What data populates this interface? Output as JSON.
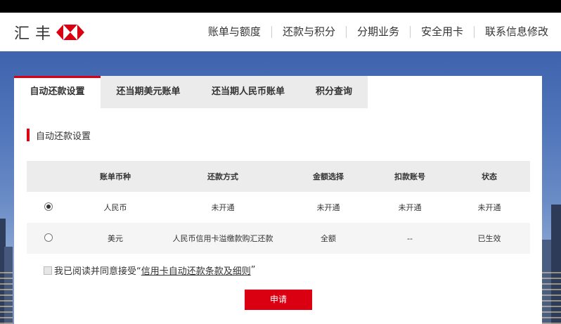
{
  "brand": {
    "name": "汇丰"
  },
  "nav": [
    {
      "label": "账单与额度"
    },
    {
      "label": "还款与积分"
    },
    {
      "label": "分期业务"
    },
    {
      "label": "安全用卡"
    },
    {
      "label": "联系信息修改"
    }
  ],
  "tabs": [
    {
      "label": "自动还款设置"
    },
    {
      "label": "还当期美元账单"
    },
    {
      "label": "还当期人民币账单"
    },
    {
      "label": "积分查询"
    }
  ],
  "section_title": "自动还款设置",
  "table": {
    "headers": [
      "账单币种",
      "还款方式",
      "金额选择",
      "扣款账号",
      "状态"
    ],
    "rows": [
      {
        "selected": true,
        "cells": [
          "人民币",
          "未开通",
          "未开通",
          "未开通",
          "未开通"
        ]
      },
      {
        "selected": false,
        "cells": [
          "美元",
          "人民币信用卡溢缴款购汇还款",
          "全额",
          "--",
          "已生效"
        ]
      }
    ]
  },
  "agree": {
    "prefix": "我已阅读并同意接受“",
    "link": "信用卡自动还款条款及细则",
    "suffix": "”"
  },
  "apply_label": "申请",
  "colors": {
    "accent": "#db0011"
  }
}
